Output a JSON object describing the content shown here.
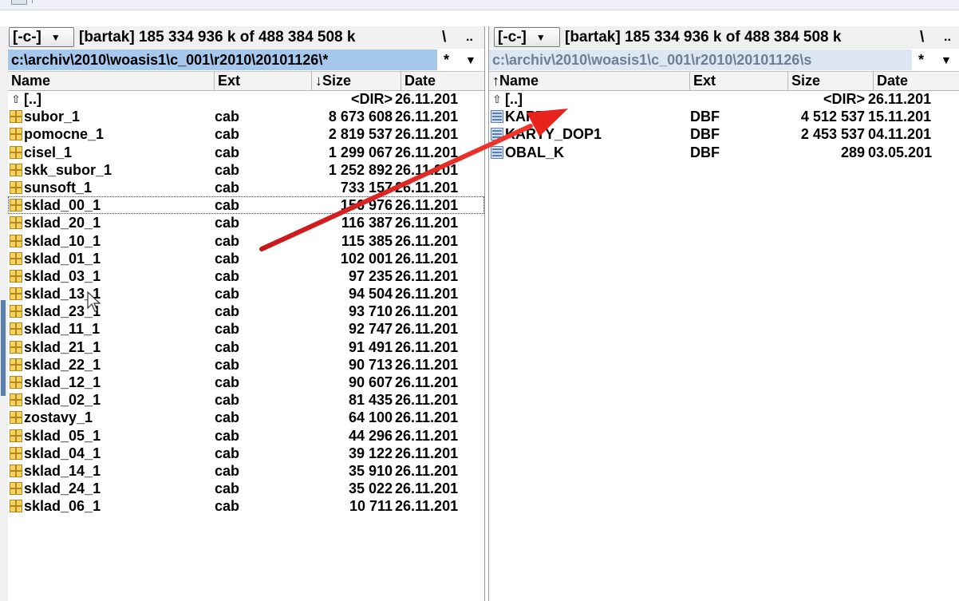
{
  "left_panel": {
    "drive_label": "[-c-]",
    "free_space": "[bartak]  185 334 936 k of 488 384 508 k",
    "root_label": "\\",
    "up_label": "..",
    "path": "c:\\archiv\\2010\\woasis1\\c_001\\r2010\\20101126\\*",
    "filter": "*",
    "columns": {
      "name": "Name",
      "ext": "Ext",
      "size": "↓Size",
      "date": "Date"
    },
    "rows": [
      {
        "name": "[..]",
        "ext": "",
        "size": "<DIR>",
        "date": "26.11.201",
        "icon": "up-folder-icon"
      },
      {
        "name": "subor_1",
        "ext": "cab",
        "size": "8 673 608",
        "date": "26.11.201",
        "icon": "cab-file-icon"
      },
      {
        "name": "pomocne_1",
        "ext": "cab",
        "size": "2 819 537",
        "date": "26.11.201",
        "icon": "cab-file-icon"
      },
      {
        "name": "cisel_1",
        "ext": "cab",
        "size": "1 299 067",
        "date": "26.11.201",
        "icon": "cab-file-icon"
      },
      {
        "name": "skk_subor_1",
        "ext": "cab",
        "size": "1 252 892",
        "date": "26.11.201",
        "icon": "cab-file-icon"
      },
      {
        "name": "sunsoft_1",
        "ext": "cab",
        "size": "733 157",
        "date": "26.11.201",
        "icon": "cab-file-icon"
      },
      {
        "name": "sklad_00_1",
        "ext": "cab",
        "size": "156 976",
        "date": "26.11.201",
        "icon": "cab-file-icon"
      },
      {
        "name": "sklad_20_1",
        "ext": "cab",
        "size": "116 387",
        "date": "26.11.201",
        "icon": "cab-file-icon"
      },
      {
        "name": "sklad_10_1",
        "ext": "cab",
        "size": "115 385",
        "date": "26.11.201",
        "icon": "cab-file-icon"
      },
      {
        "name": "sklad_01_1",
        "ext": "cab",
        "size": "102 001",
        "date": "26.11.201",
        "icon": "cab-file-icon"
      },
      {
        "name": "sklad_03_1",
        "ext": "cab",
        "size": "97 235",
        "date": "26.11.201",
        "icon": "cab-file-icon"
      },
      {
        "name": "sklad_13_1",
        "ext": "cab",
        "size": "94 504",
        "date": "26.11.201",
        "icon": "cab-file-icon"
      },
      {
        "name": "sklad_23_1",
        "ext": "cab",
        "size": "93 710",
        "date": "26.11.201",
        "icon": "cab-file-icon"
      },
      {
        "name": "sklad_11_1",
        "ext": "cab",
        "size": "92 747",
        "date": "26.11.201",
        "icon": "cab-file-icon"
      },
      {
        "name": "sklad_21_1",
        "ext": "cab",
        "size": "91 491",
        "date": "26.11.201",
        "icon": "cab-file-icon"
      },
      {
        "name": "sklad_22_1",
        "ext": "cab",
        "size": "90 713",
        "date": "26.11.201",
        "icon": "cab-file-icon"
      },
      {
        "name": "sklad_12_1",
        "ext": "cab",
        "size": "90 607",
        "date": "26.11.201",
        "icon": "cab-file-icon"
      },
      {
        "name": "sklad_02_1",
        "ext": "cab",
        "size": "81 435",
        "date": "26.11.201",
        "icon": "cab-file-icon"
      },
      {
        "name": "zostavy_1",
        "ext": "cab",
        "size": "64 100",
        "date": "26.11.201",
        "icon": "cab-file-icon"
      },
      {
        "name": "sklad_05_1",
        "ext": "cab",
        "size": "44 296",
        "date": "26.11.201",
        "icon": "cab-file-icon"
      },
      {
        "name": "sklad_04_1",
        "ext": "cab",
        "size": "39 122",
        "date": "26.11.201",
        "icon": "cab-file-icon"
      },
      {
        "name": "sklad_14_1",
        "ext": "cab",
        "size": "35 910",
        "date": "26.11.201",
        "icon": "cab-file-icon"
      },
      {
        "name": "sklad_24_1",
        "ext": "cab",
        "size": "35 022",
        "date": "26.11.201",
        "icon": "cab-file-icon"
      },
      {
        "name": "sklad_06_1",
        "ext": "cab",
        "size": "10 711",
        "date": "26.11.201",
        "icon": "cab-file-icon"
      }
    ]
  },
  "right_panel": {
    "drive_label": "[-c-]",
    "free_space": "[bartak]  185 334 936 k of 488 384 508 k",
    "root_label": "\\",
    "up_label": "..",
    "path": "c:\\archiv\\2010\\woasis1\\c_001\\r2010\\20101126\\s",
    "filter": "*",
    "columns": {
      "name": "↑Name",
      "ext": "Ext",
      "size": "Size",
      "date": "Date"
    },
    "rows": [
      {
        "name": "[..]",
        "ext": "",
        "size": "<DIR>",
        "date": "26.11.201",
        "icon": "up-folder-icon"
      },
      {
        "name": "KARTY",
        "ext": "DBF",
        "size": "4 512 537",
        "date": "15.11.201",
        "icon": "dbf-file-icon"
      },
      {
        "name": "KARTY_DOP1",
        "ext": "DBF",
        "size": "2 453 537",
        "date": "04.11.201",
        "icon": "dbf-file-icon"
      },
      {
        "name": "OBAL_K",
        "ext": "DBF",
        "size": "289",
        "date": "03.05.201",
        "icon": "dbf-file-icon"
      }
    ]
  },
  "colors": {
    "active_path_bg": "#a6c8ed",
    "inactive_path_bg": "#dce7f3",
    "annotation_arrow": "#e8231d"
  }
}
